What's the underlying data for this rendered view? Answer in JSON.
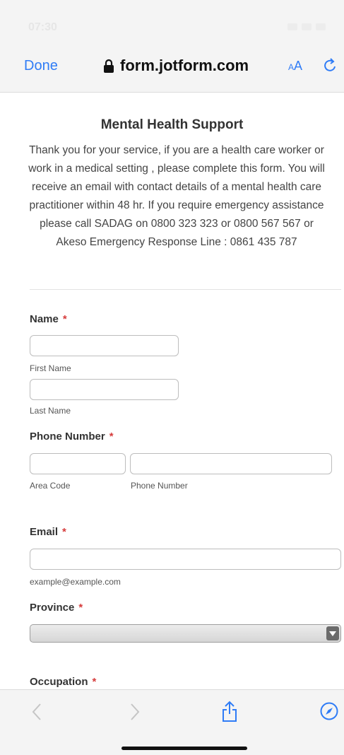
{
  "status_bar": {
    "time": "07:30"
  },
  "browser": {
    "done_label": "Done",
    "url": "form.jotform.com",
    "text_size_label_small": "A",
    "text_size_label_large": "A"
  },
  "form": {
    "title": "Mental Health Support",
    "description": "Thank you for your service, if you are a health care worker or work in a medical setting , please complete this form. You will receive an email with contact details of a mental health care practitioner within 48 hr. If you require emergency assistance please call SADAG on 0800 323 323 or 0800 567 567 or Akeso Emergency Response Line : 0861 435 787",
    "required_mark": "*",
    "name": {
      "label": "Name",
      "first_sublabel": "First Name",
      "last_sublabel": "Last Name",
      "first_value": "",
      "last_value": ""
    },
    "phone": {
      "label": "Phone Number",
      "area_sublabel": "Area Code",
      "number_sublabel": "Phone Number",
      "area_value": "",
      "number_value": ""
    },
    "email": {
      "label": "Email",
      "sublabel": "example@example.com",
      "value": ""
    },
    "province": {
      "label": "Province",
      "selected": ""
    },
    "occupation": {
      "label": "Occupation"
    }
  },
  "toolbar": {
    "icons": [
      "back-icon",
      "forward-icon",
      "share-icon",
      "compass-icon"
    ]
  },
  "colors": {
    "accent": "#2f7cf6",
    "required": "#d63c3c"
  }
}
